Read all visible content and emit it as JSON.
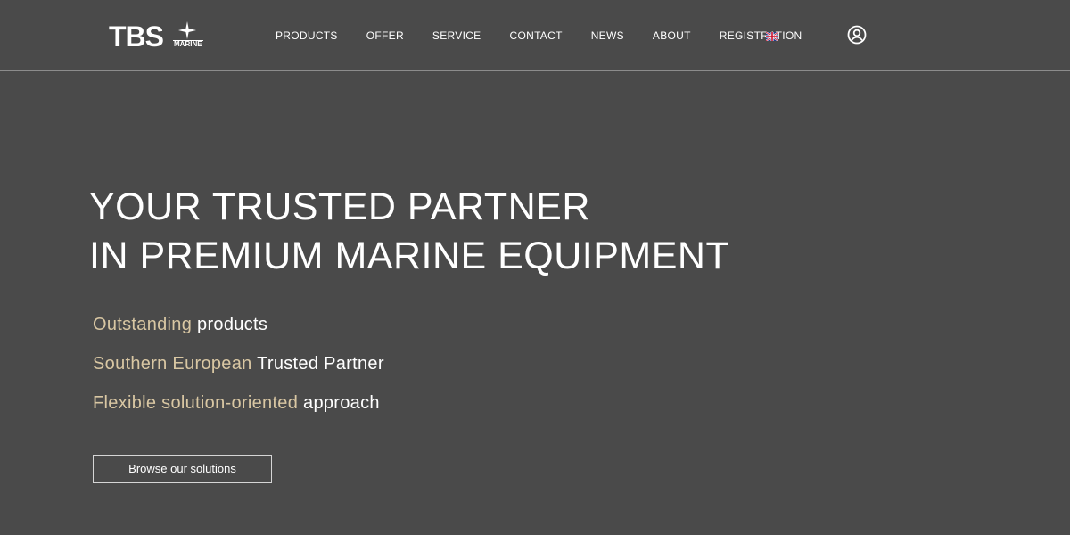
{
  "header": {
    "logo_text": "TBS",
    "logo_subtext": "MARINE",
    "nav": [
      {
        "label": "PRODUCTS"
      },
      {
        "label": "OFFER"
      },
      {
        "label": "SERVICE"
      },
      {
        "label": "CONTACT"
      },
      {
        "label": "NEWS"
      },
      {
        "label": "ABOUT"
      },
      {
        "label": "REGISTRATION"
      }
    ],
    "language_icon": "uk-flag-icon",
    "account_icon": "user-circle-icon"
  },
  "hero": {
    "title_line1": "YOUR TRUSTED PARTNER",
    "title_line2": "IN PREMIUM MARINE EQUIPMENT",
    "features": [
      {
        "accent": "Outstanding",
        "rest": "products"
      },
      {
        "accent": "Southern European",
        "rest": "Trusted Partner"
      },
      {
        "accent": "Flexible solution-oriented",
        "rest": "approach"
      }
    ],
    "cta_label": "Browse our solutions"
  },
  "colors": {
    "background": "#4a4a4a",
    "accent": "#d9c7a3",
    "text": "#ffffff",
    "divider": "#8c8c8c"
  }
}
